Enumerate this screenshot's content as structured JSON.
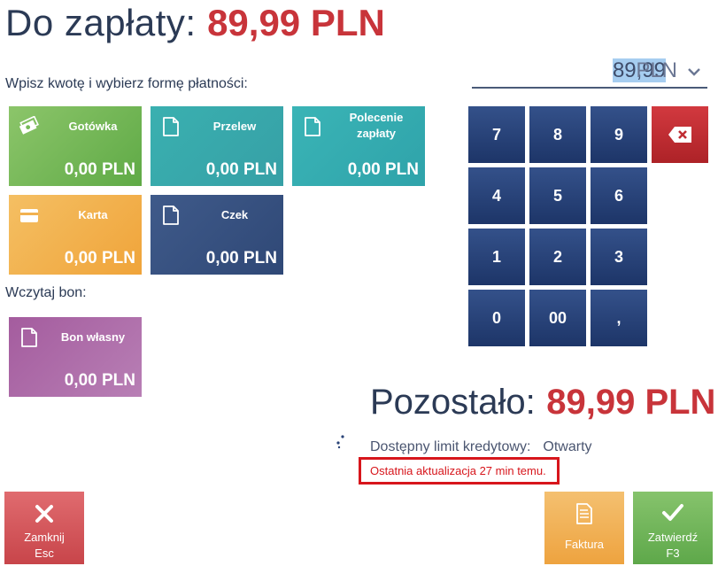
{
  "header": {
    "title": "Do zapłaty:",
    "amount": "89,99 PLN"
  },
  "instruction": "Wpisz kwotę i wybierz formę płatności:",
  "payment_methods": [
    {
      "name": "Gotówka",
      "amount": "0,00 PLN",
      "icon": "cash-icon",
      "color": "#75b957"
    },
    {
      "name": "Przelew",
      "amount": "0,00 PLN",
      "icon": "document-icon",
      "color": "#38a9ad"
    },
    {
      "name": "Polecenie zapłaty",
      "amount": "0,00 PLN",
      "icon": "document-icon",
      "color": "#34abb0"
    },
    {
      "name": "Karta",
      "amount": "0,00 PLN",
      "icon": "card-icon",
      "color": "#f2b14f"
    },
    {
      "name": "Czek",
      "amount": "0,00 PLN",
      "icon": "document-icon",
      "color": "#375180"
    }
  ],
  "voucher": {
    "label": "Wczytaj bon:",
    "tile": {
      "name": "Bon własny",
      "amount": "0,00 PLN",
      "icon": "document-icon",
      "color": "#ae6daa"
    }
  },
  "amount_input": {
    "value": "89,99",
    "currency": "PLN"
  },
  "keypad": {
    "keys": [
      "7",
      "8",
      "9",
      "4",
      "5",
      "6",
      "1",
      "2",
      "3",
      "0",
      "00",
      ","
    ],
    "backspace_icon": "backspace-icon"
  },
  "remaining": {
    "label": "Pozostało:",
    "amount": "89,99 PLN"
  },
  "credit": {
    "label": "Dostępny limit kredytowy:",
    "value": "Otwarty"
  },
  "last_update": "Ostatnia aktualizacja 27 min temu.",
  "buttons": {
    "close": {
      "label": "Zamknij",
      "shortcut": "Esc",
      "icon": "close-icon"
    },
    "invoice": {
      "label": "Faktura",
      "icon": "invoice-icon"
    },
    "confirm": {
      "label": "Zatwierdź",
      "shortcut": "F3",
      "icon": "check-icon"
    }
  },
  "colors": {
    "accent_red": "#c8343a",
    "text_navy": "#2b3a55",
    "keypad": "#2a4478",
    "highlight_border": "#d7161c"
  }
}
